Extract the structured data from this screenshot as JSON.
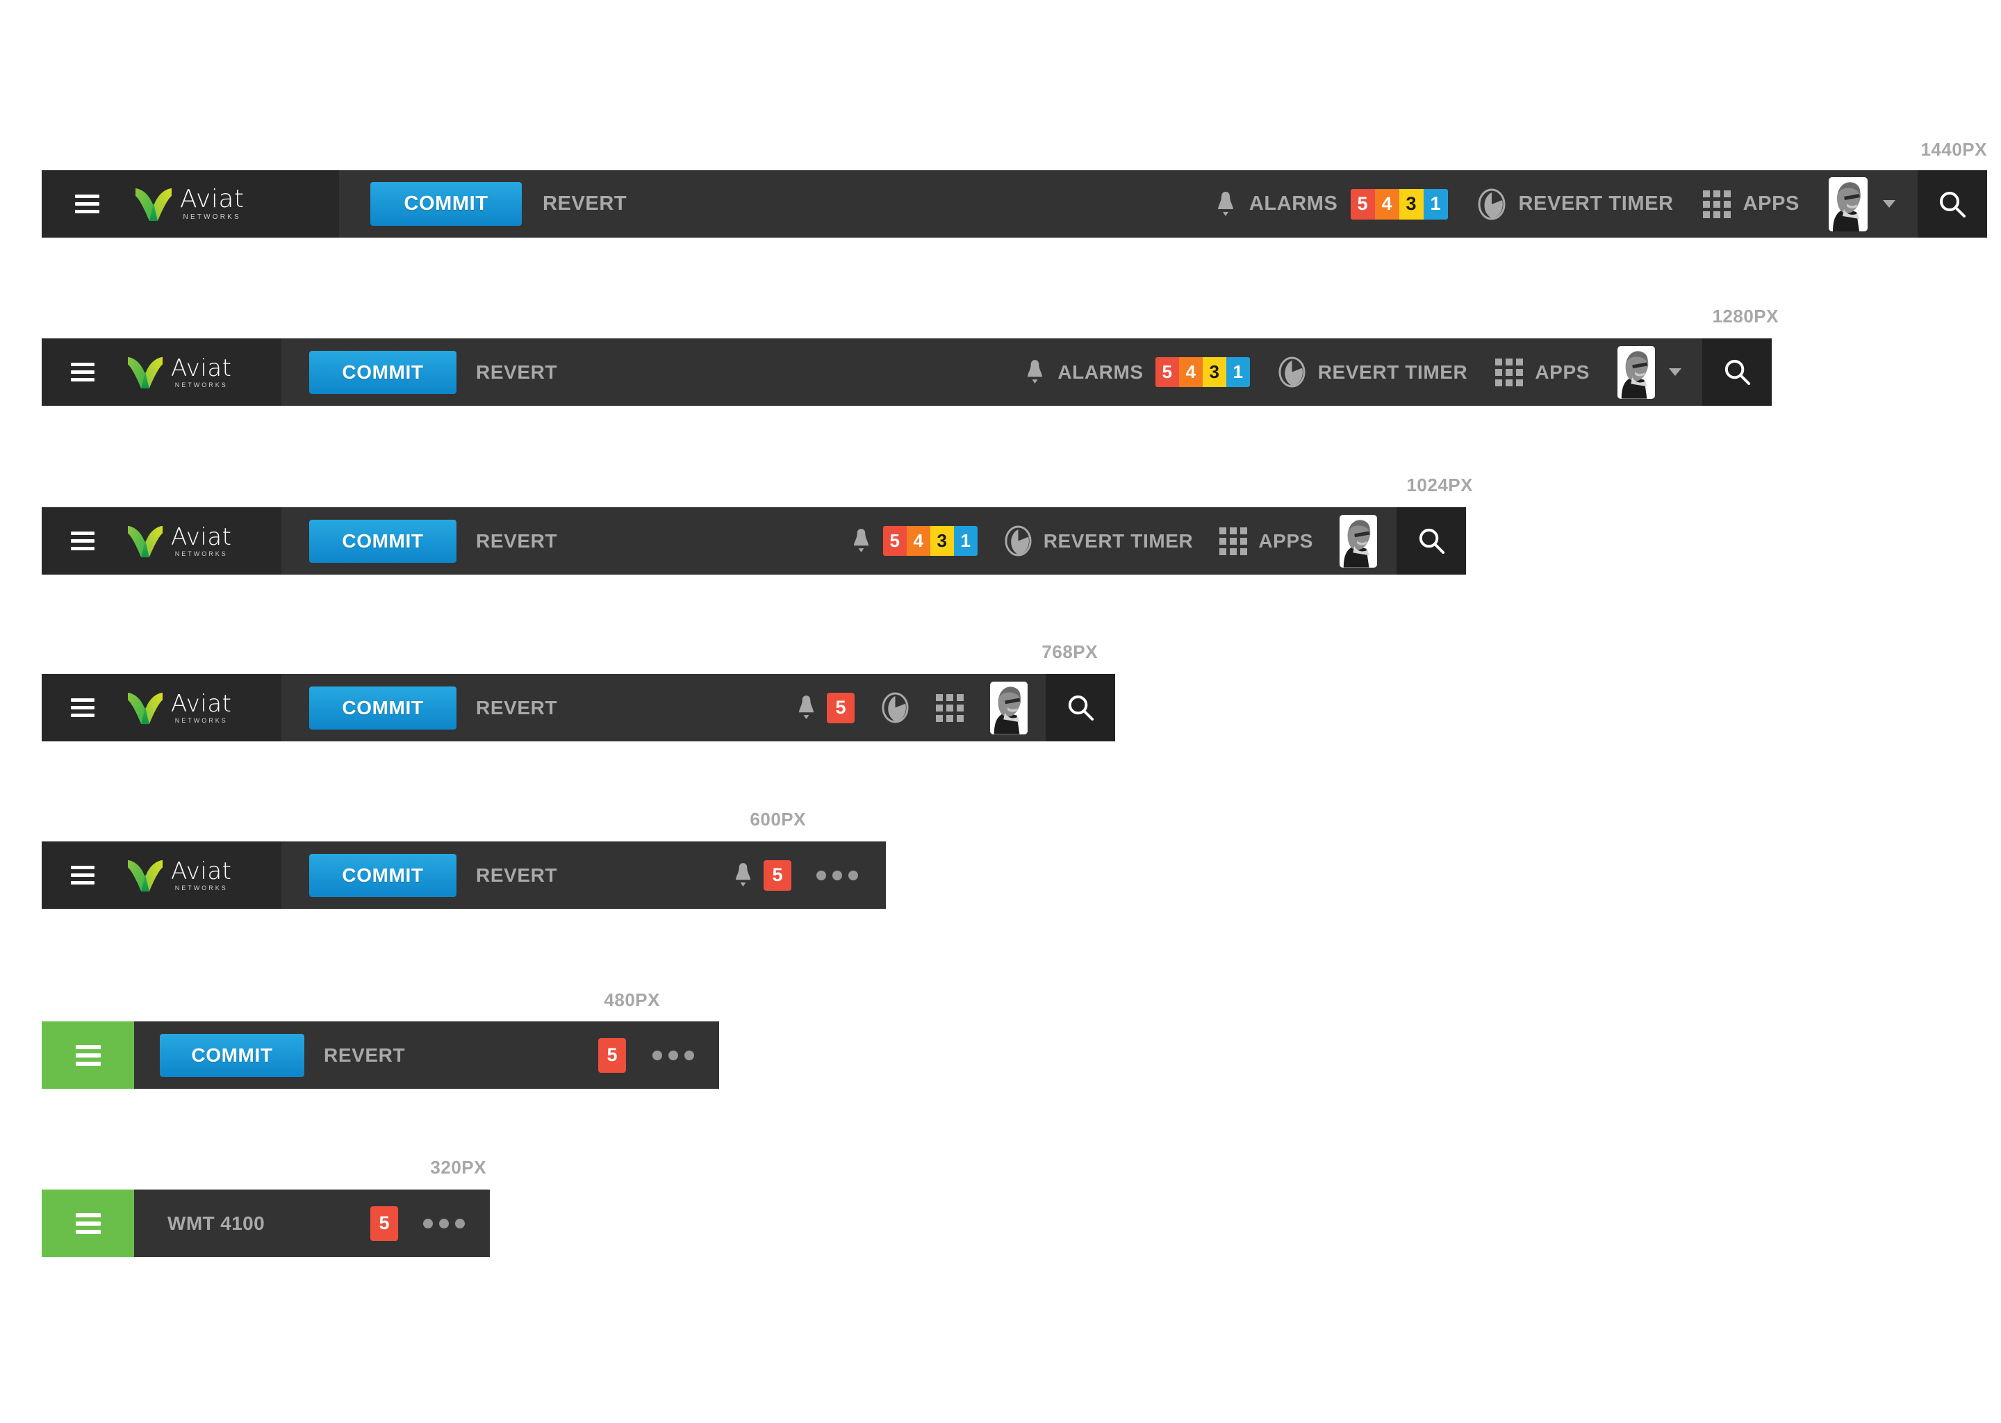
{
  "page": {
    "background": "#ffffff",
    "bar_bg": "#333333",
    "brand_panel_bg": "#282828",
    "search_panel_bg": "#222222",
    "label_color": "#a7a7a7",
    "muted_text": "#a9a9a9",
    "green_panel": "#6abf4b",
    "accent_blue": "#0d86cb"
  },
  "brand": {
    "name": "Aviat",
    "tagline": "NETWORKS",
    "logo_icon": "aviat-leaf-logo",
    "menu_icon": "hamburger-menu-icon"
  },
  "actions": {
    "commit_label": "COMMIT",
    "revert_label": "REVERT"
  },
  "alarms": {
    "label": "ALARMS",
    "bell_icon": "bell-icon",
    "counts": [
      {
        "value": "5",
        "bg": "#ee4e3c",
        "fg": "#ffffff",
        "severity": "critical"
      },
      {
        "value": "4",
        "bg": "#f57c1f",
        "fg": "#ffffff",
        "severity": "major"
      },
      {
        "value": "3",
        "bg": "#fbd213",
        "fg": "#1a1a1a",
        "severity": "minor"
      },
      {
        "value": "1",
        "bg": "#1fa0dc",
        "fg": "#ffffff",
        "severity": "info"
      }
    ],
    "single_count": "5",
    "single_bg": "#ee4e3c"
  },
  "revert_timer": {
    "label": "REVERT TIMER",
    "icon": "pie-timer-icon"
  },
  "apps": {
    "label": "APPS",
    "icon": "apps-grid-icon"
  },
  "user": {
    "avatar_icon": "user-avatar",
    "caret_icon": "chevron-down-icon"
  },
  "search": {
    "icon": "search-icon"
  },
  "overflow": {
    "icon": "ellipsis-icon"
  },
  "device": {
    "title": "WMT 4100"
  },
  "breakpoints": [
    {
      "id": "bp1440",
      "label": "1440PX"
    },
    {
      "id": "bp1280",
      "label": "1280PX"
    },
    {
      "id": "bp1024",
      "label": "1024PX"
    },
    {
      "id": "bp768",
      "label": "768PX"
    },
    {
      "id": "bp600",
      "label": "600PX"
    },
    {
      "id": "bp480",
      "label": "480PX"
    },
    {
      "id": "bp320",
      "label": "320PX"
    }
  ]
}
